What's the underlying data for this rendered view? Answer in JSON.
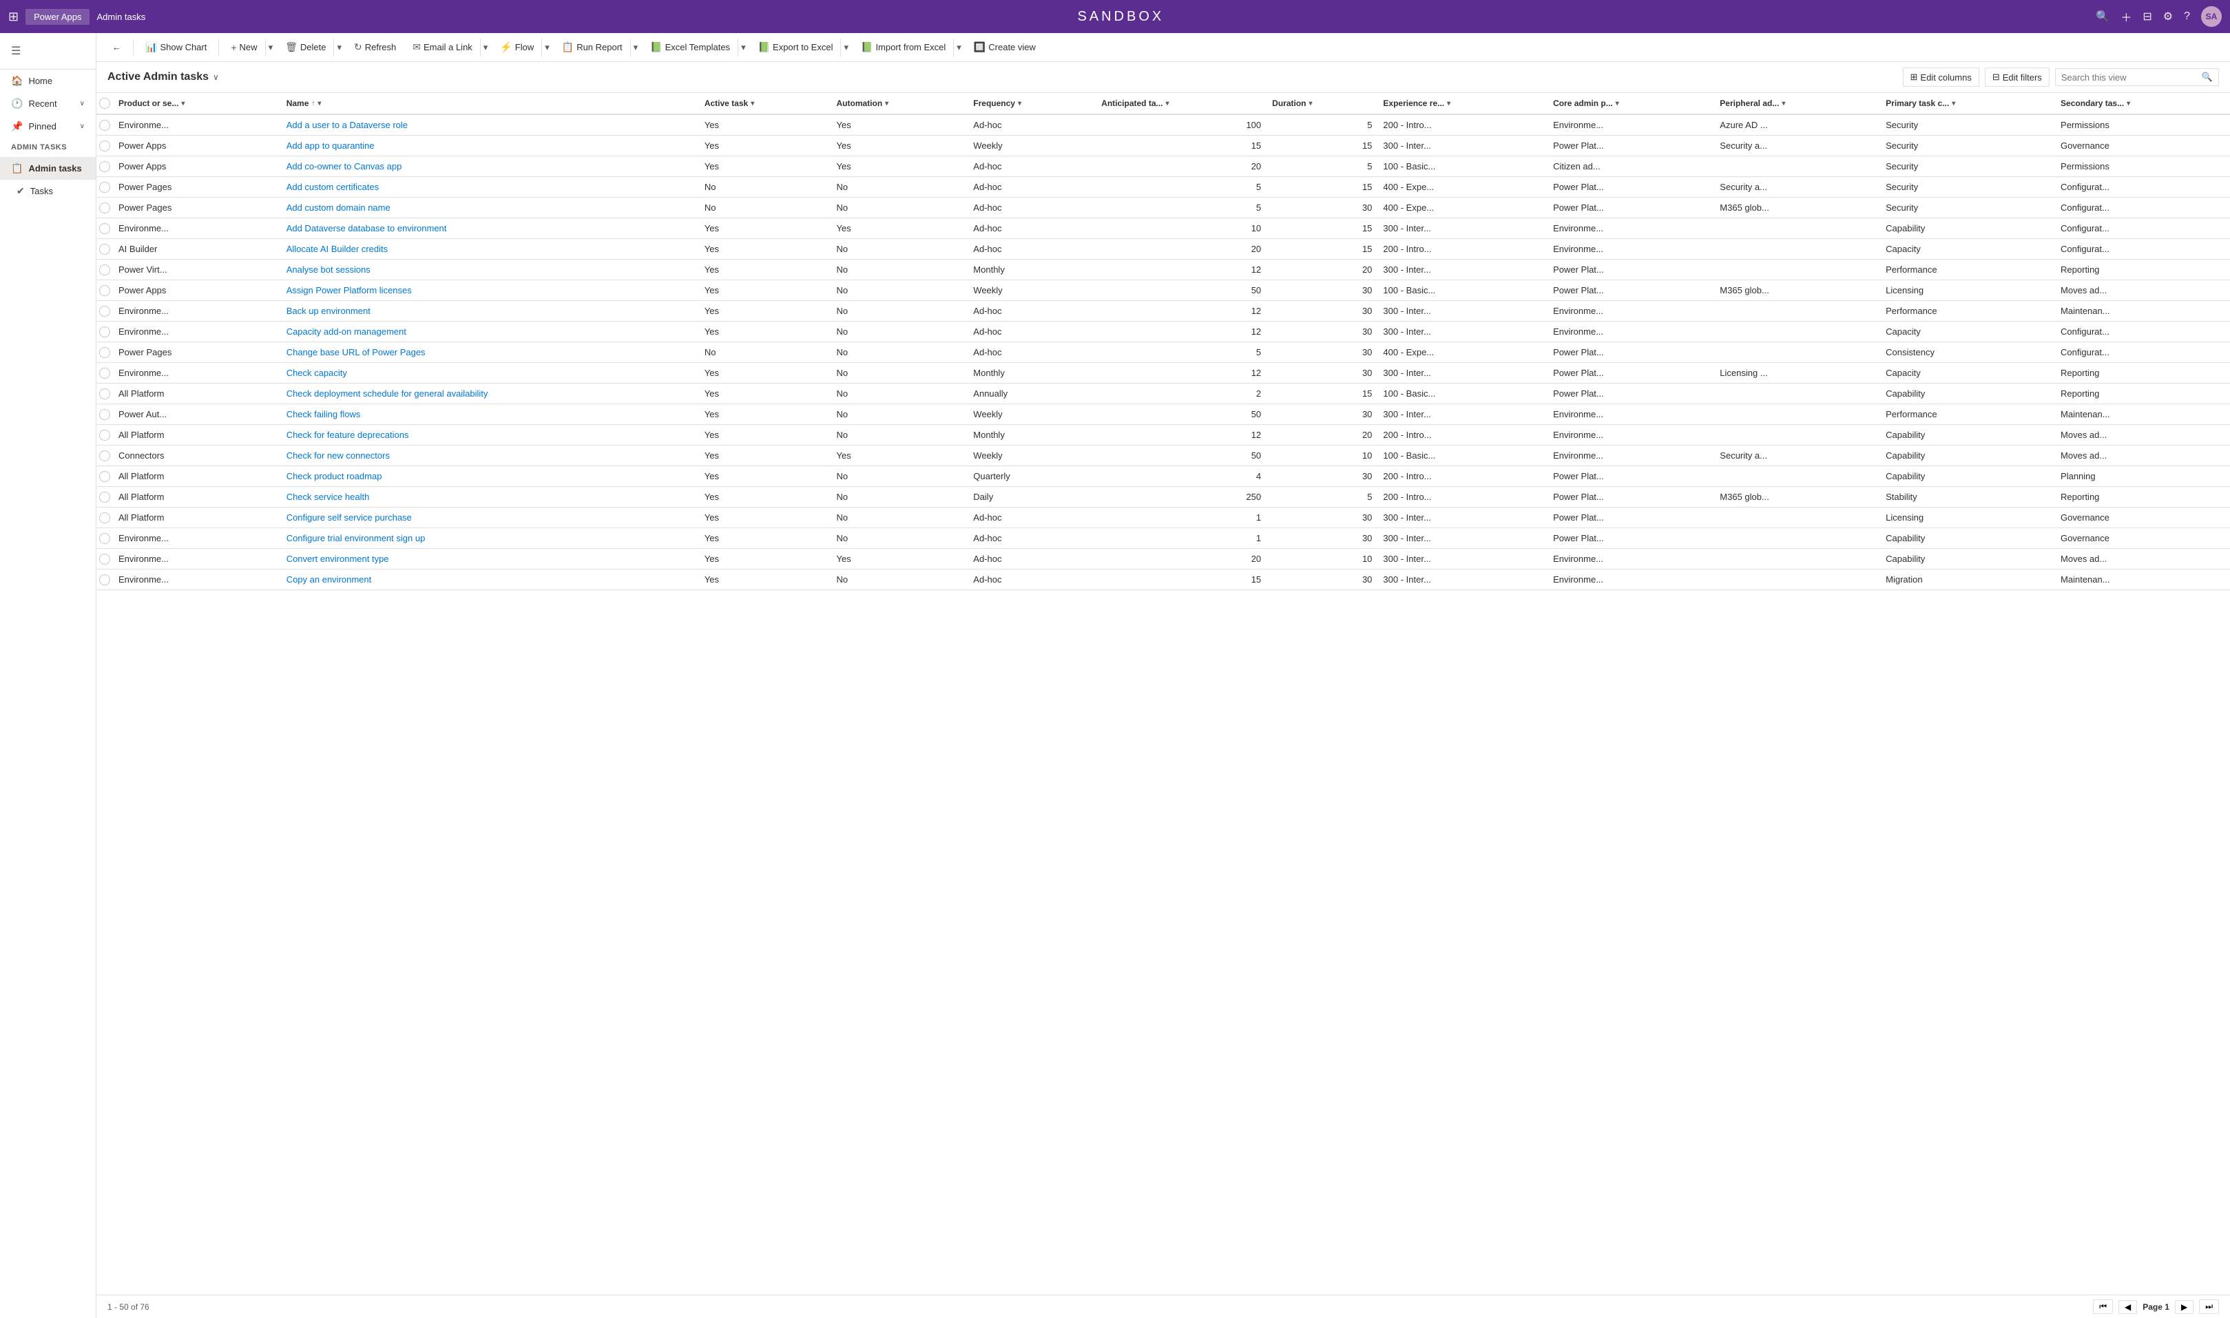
{
  "app": {
    "grid_icon": "⊞",
    "name": "Power Apps",
    "context": "Admin tasks",
    "sandbox_title": "SANDBOX",
    "nav_icons": [
      "🔍",
      "+",
      "⊟",
      "⚙",
      "?"
    ],
    "avatar_initials": "SA"
  },
  "sidebar": {
    "hamburger": "☰",
    "items": [
      {
        "id": "home",
        "label": "Home",
        "icon": "🏠"
      },
      {
        "id": "recent",
        "label": "Recent",
        "icon": "🕐",
        "expandable": true
      },
      {
        "id": "pinned",
        "label": "Pinned",
        "icon": "📌",
        "expandable": true
      }
    ],
    "group_label": "Admin tasks",
    "sub_items": [
      {
        "id": "admin-tasks",
        "label": "Admin tasks",
        "icon": "📋",
        "active": true
      },
      {
        "id": "tasks",
        "label": "Tasks",
        "icon": "✔"
      }
    ]
  },
  "toolbar": {
    "back_label": "←",
    "show_chart_label": "Show Chart",
    "show_chart_icon": "📊",
    "new_label": "New",
    "new_icon": "+",
    "delete_label": "Delete",
    "delete_icon": "🗑",
    "refresh_label": "Refresh",
    "refresh_icon": "↻",
    "email_link_label": "Email a Link",
    "email_link_icon": "✉",
    "flow_label": "Flow",
    "flow_icon": "⚡",
    "run_report_label": "Run Report",
    "run_report_icon": "📋",
    "excel_templates_label": "Excel Templates",
    "excel_templates_icon": "📗",
    "export_excel_label": "Export to Excel",
    "export_excel_icon": "📗",
    "import_excel_label": "Import from Excel",
    "import_excel_icon": "📗",
    "create_view_label": "Create view",
    "create_view_icon": "🔲"
  },
  "view": {
    "title": "Active Admin tasks",
    "edit_columns_label": "Edit columns",
    "edit_filters_label": "Edit filters",
    "search_placeholder": "Search this view"
  },
  "table": {
    "columns": [
      {
        "id": "product",
        "label": "Product or se...",
        "sortable": true,
        "filterable": true
      },
      {
        "id": "name",
        "label": "Name",
        "sortable": true,
        "filterable": true
      },
      {
        "id": "active_task",
        "label": "Active task",
        "sortable": true,
        "filterable": true
      },
      {
        "id": "automation",
        "label": "Automation",
        "sortable": true,
        "filterable": true
      },
      {
        "id": "frequency",
        "label": "Frequency",
        "sortable": true,
        "filterable": true
      },
      {
        "id": "anticipated",
        "label": "Anticipated ta...",
        "sortable": true,
        "filterable": true
      },
      {
        "id": "duration",
        "label": "Duration",
        "sortable": true,
        "filterable": true
      },
      {
        "id": "experience",
        "label": "Experience re...",
        "sortable": true,
        "filterable": true
      },
      {
        "id": "core_admin",
        "label": "Core admin p...",
        "sortable": true,
        "filterable": true
      },
      {
        "id": "peripheral",
        "label": "Peripheral ad...",
        "sortable": true,
        "filterable": true
      },
      {
        "id": "primary_task",
        "label": "Primary task c...",
        "sortable": true,
        "filterable": true
      },
      {
        "id": "secondary",
        "label": "Secondary tas...",
        "sortable": true,
        "filterable": true
      }
    ],
    "rows": [
      {
        "product": "Environme...",
        "name": "Add a user to a Dataverse role",
        "active_task": "Yes",
        "automation": "Yes",
        "frequency": "Ad-hoc",
        "anticipated": "100",
        "duration": "5",
        "experience": "200 - Intro...",
        "core_admin": "Environme...",
        "peripheral": "Azure AD ...",
        "primary_task": "Security",
        "secondary": "Permissions"
      },
      {
        "product": "Power Apps",
        "name": "Add app to quarantine",
        "active_task": "Yes",
        "automation": "Yes",
        "frequency": "Weekly",
        "anticipated": "15",
        "duration": "15",
        "experience": "300 - Inter...",
        "core_admin": "Power Plat...",
        "peripheral": "Security a...",
        "primary_task": "Security",
        "secondary": "Governance"
      },
      {
        "product": "Power Apps",
        "name": "Add co-owner to Canvas app",
        "active_task": "Yes",
        "automation": "Yes",
        "frequency": "Ad-hoc",
        "anticipated": "20",
        "duration": "5",
        "experience": "100 - Basic...",
        "core_admin": "Citizen ad...",
        "peripheral": "",
        "primary_task": "Security",
        "secondary": "Permissions"
      },
      {
        "product": "Power Pages",
        "name": "Add custom certificates",
        "active_task": "No",
        "automation": "No",
        "frequency": "Ad-hoc",
        "anticipated": "5",
        "duration": "15",
        "experience": "400 - Expe...",
        "core_admin": "Power Plat...",
        "peripheral": "Security a...",
        "primary_task": "Security",
        "secondary": "Configurat..."
      },
      {
        "product": "Power Pages",
        "name": "Add custom domain name",
        "active_task": "No",
        "automation": "No",
        "frequency": "Ad-hoc",
        "anticipated": "5",
        "duration": "30",
        "experience": "400 - Expe...",
        "core_admin": "Power Plat...",
        "peripheral": "M365 glob...",
        "primary_task": "Security",
        "secondary": "Configurat..."
      },
      {
        "product": "Environme...",
        "name": "Add Dataverse database to environment",
        "active_task": "Yes",
        "automation": "Yes",
        "frequency": "Ad-hoc",
        "anticipated": "10",
        "duration": "15",
        "experience": "300 - Inter...",
        "core_admin": "Environme...",
        "peripheral": "",
        "primary_task": "Capability",
        "secondary": "Configurat..."
      },
      {
        "product": "AI Builder",
        "name": "Allocate AI Builder credits",
        "active_task": "Yes",
        "automation": "No",
        "frequency": "Ad-hoc",
        "anticipated": "20",
        "duration": "15",
        "experience": "200 - Intro...",
        "core_admin": "Environme...",
        "peripheral": "",
        "primary_task": "Capacity",
        "secondary": "Configurat..."
      },
      {
        "product": "Power Virt...",
        "name": "Analyse bot sessions",
        "active_task": "Yes",
        "automation": "No",
        "frequency": "Monthly",
        "anticipated": "12",
        "duration": "20",
        "experience": "300 - Inter...",
        "core_admin": "Power Plat...",
        "peripheral": "",
        "primary_task": "Performance",
        "secondary": "Reporting"
      },
      {
        "product": "Power Apps",
        "name": "Assign Power Platform licenses",
        "active_task": "Yes",
        "automation": "No",
        "frequency": "Weekly",
        "anticipated": "50",
        "duration": "30",
        "experience": "100 - Basic...",
        "core_admin": "Power Plat...",
        "peripheral": "M365 glob...",
        "primary_task": "Licensing",
        "secondary": "Moves ad..."
      },
      {
        "product": "Environme...",
        "name": "Back up environment",
        "active_task": "Yes",
        "automation": "No",
        "frequency": "Ad-hoc",
        "anticipated": "12",
        "duration": "30",
        "experience": "300 - Inter...",
        "core_admin": "Environme...",
        "peripheral": "",
        "primary_task": "Performance",
        "secondary": "Maintenan..."
      },
      {
        "product": "Environme...",
        "name": "Capacity add-on management",
        "active_task": "Yes",
        "automation": "No",
        "frequency": "Ad-hoc",
        "anticipated": "12",
        "duration": "30",
        "experience": "300 - Inter...",
        "core_admin": "Environme...",
        "peripheral": "",
        "primary_task": "Capacity",
        "secondary": "Configurat..."
      },
      {
        "product": "Power Pages",
        "name": "Change base URL of Power Pages",
        "active_task": "No",
        "automation": "No",
        "frequency": "Ad-hoc",
        "anticipated": "5",
        "duration": "30",
        "experience": "400 - Expe...",
        "core_admin": "Power Plat...",
        "peripheral": "",
        "primary_task": "Consistency",
        "secondary": "Configurat..."
      },
      {
        "product": "Environme...",
        "name": "Check capacity",
        "active_task": "Yes",
        "automation": "No",
        "frequency": "Monthly",
        "anticipated": "12",
        "duration": "30",
        "experience": "300 - Inter...",
        "core_admin": "Power Plat...",
        "peripheral": "Licensing ...",
        "primary_task": "Capacity",
        "secondary": "Reporting"
      },
      {
        "product": "All Platform",
        "name": "Check deployment schedule for general availability",
        "active_task": "Yes",
        "automation": "No",
        "frequency": "Annually",
        "anticipated": "2",
        "duration": "15",
        "experience": "100 - Basic...",
        "core_admin": "Power Plat...",
        "peripheral": "",
        "primary_task": "Capability",
        "secondary": "Reporting"
      },
      {
        "product": "Power Aut...",
        "name": "Check failing flows",
        "active_task": "Yes",
        "automation": "No",
        "frequency": "Weekly",
        "anticipated": "50",
        "duration": "30",
        "experience": "300 - Inter...",
        "core_admin": "Environme...",
        "peripheral": "",
        "primary_task": "Performance",
        "secondary": "Maintenan..."
      },
      {
        "product": "All Platform",
        "name": "Check for feature deprecations",
        "active_task": "Yes",
        "automation": "No",
        "frequency": "Monthly",
        "anticipated": "12",
        "duration": "20",
        "experience": "200 - Intro...",
        "core_admin": "Environme...",
        "peripheral": "",
        "primary_task": "Capability",
        "secondary": "Moves ad..."
      },
      {
        "product": "Connectors",
        "name": "Check for new connectors",
        "active_task": "Yes",
        "automation": "Yes",
        "frequency": "Weekly",
        "anticipated": "50",
        "duration": "10",
        "experience": "100 - Basic...",
        "core_admin": "Environme...",
        "peripheral": "Security a...",
        "primary_task": "Capability",
        "secondary": "Moves ad..."
      },
      {
        "product": "All Platform",
        "name": "Check product roadmap",
        "active_task": "Yes",
        "automation": "No",
        "frequency": "Quarterly",
        "anticipated": "4",
        "duration": "30",
        "experience": "200 - Intro...",
        "core_admin": "Power Plat...",
        "peripheral": "",
        "primary_task": "Capability",
        "secondary": "Planning"
      },
      {
        "product": "All Platform",
        "name": "Check service health",
        "active_task": "Yes",
        "automation": "No",
        "frequency": "Daily",
        "anticipated": "250",
        "duration": "5",
        "experience": "200 - Intro...",
        "core_admin": "Power Plat...",
        "peripheral": "M365 glob...",
        "primary_task": "Stability",
        "secondary": "Reporting"
      },
      {
        "product": "All Platform",
        "name": "Configure self service purchase",
        "active_task": "Yes",
        "automation": "No",
        "frequency": "Ad-hoc",
        "anticipated": "1",
        "duration": "30",
        "experience": "300 - Inter...",
        "core_admin": "Power Plat...",
        "peripheral": "",
        "primary_task": "Licensing",
        "secondary": "Governance"
      },
      {
        "product": "Environme...",
        "name": "Configure trial environment sign up",
        "active_task": "Yes",
        "automation": "No",
        "frequency": "Ad-hoc",
        "anticipated": "1",
        "duration": "30",
        "experience": "300 - Inter...",
        "core_admin": "Power Plat...",
        "peripheral": "",
        "primary_task": "Capability",
        "secondary": "Governance"
      },
      {
        "product": "Environme...",
        "name": "Convert environment type",
        "active_task": "Yes",
        "automation": "Yes",
        "frequency": "Ad-hoc",
        "anticipated": "20",
        "duration": "10",
        "experience": "300 - Inter...",
        "core_admin": "Environme...",
        "peripheral": "",
        "primary_task": "Capability",
        "secondary": "Moves ad..."
      },
      {
        "product": "Environme...",
        "name": "Copy an environment",
        "active_task": "Yes",
        "automation": "No",
        "frequency": "Ad-hoc",
        "anticipated": "15",
        "duration": "30",
        "experience": "300 - Inter...",
        "core_admin": "Environme...",
        "peripheral": "",
        "primary_task": "Migration",
        "secondary": "Maintenan..."
      }
    ]
  },
  "footer": {
    "range_text": "1 - 50 of 76",
    "first_page_icon": "⏮",
    "prev_page_icon": "◀",
    "next_page_icon": "▶",
    "last_page_icon": "⏭",
    "page_label": "Page 1"
  }
}
